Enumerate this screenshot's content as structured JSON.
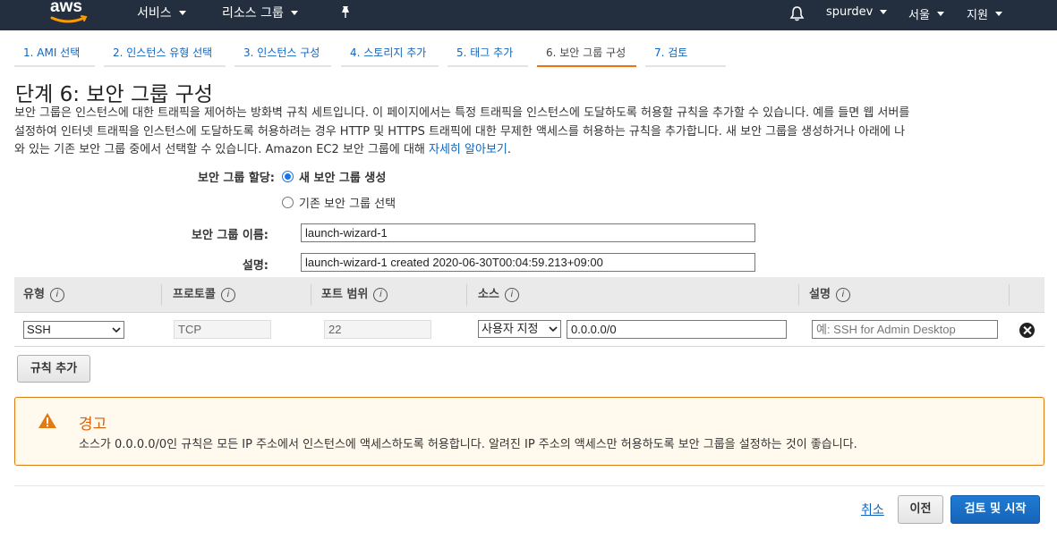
{
  "nav": {
    "logo_text": "aws",
    "services": "서비스",
    "resource_groups": "리소스 그룹",
    "account": "spurdev",
    "region": "서울",
    "support": "지원"
  },
  "steps": [
    {
      "label": "1. AMI 선택"
    },
    {
      "label": "2. 인스턴스 유형 선택"
    },
    {
      "label": "3. 인스턴스 구성"
    },
    {
      "label": "4. 스토리지 추가"
    },
    {
      "label": "5. 태그 추가"
    },
    {
      "label": "6. 보안 그룹 구성",
      "active": true
    },
    {
      "label": "7. 검토"
    }
  ],
  "page": {
    "title": "단계 6: 보안 그룹 구성",
    "description_line1": "보안 그룹은 인스턴스에 대한 트래픽을 제어하는 방화벽 규칙 세트입니다. 이 페이지에서는 특정 트래픽을 인스턴스에 도달하도록 허용할 규칙을 추가할 수 있습니다. 예를 들면 웹 서버를",
    "description_line2": "설정하여 인터넷 트래픽을 인스턴스에 도달하도록 허용하려는 경우 HTTP 및 HTTPS 트래픽에 대한 무제한 액세스를 허용하는 규칙을 추가합니다. 새 보안 그룹을 생성하거나 아래에 나",
    "description_line3": "와 있는 기존 보안 그룹 중에서 선택할 수 있습니다. Amazon EC2 보안 그룹에 대해",
    "learn_more": "자세히 알아보기",
    "period": "."
  },
  "form": {
    "assign_label": "보안 그룹 할당:",
    "option_new": "새 보안 그룹 생성",
    "option_existing": "기존 보안 그룹 선택",
    "name_label": "보안 그룹 이름:",
    "name_value": "launch-wizard-1",
    "desc_label": "설명:",
    "desc_value": "launch-wizard-1 created 2020-06-30T00:04:59.213+09:00"
  },
  "table": {
    "headers": [
      "유형",
      "프로토콜",
      "포트 범위",
      "소스",
      "설명"
    ],
    "info_glyph": "i",
    "rows": [
      {
        "type": "SSH",
        "protocol": "TCP",
        "port": "22",
        "source_type": "사용자 지정",
        "source_value": "0.0.0.0/0",
        "description_placeholder": "예: SSH for Admin Desktop"
      }
    ]
  },
  "add_rule": "규칙 추가",
  "warning": {
    "title": "경고",
    "text": "소스가 0.0.0.0/0인 규칙은 모든 IP 주소에서 인스턴스에 액세스하도록 허용합니다. 알려진 IP 주소의 액세스만 허용하도록 보안 그룹을 설정하는 것이 좋습니다."
  },
  "footer": {
    "cancel": "취소",
    "previous": "이전",
    "review_launch": "검토 및 시작"
  },
  "colors": {
    "nav_bg": "#232f3e",
    "link": "#1166bb",
    "active_step": "#ec7211",
    "warning_border": "#e07b13",
    "primary_button": "#1565b8"
  }
}
